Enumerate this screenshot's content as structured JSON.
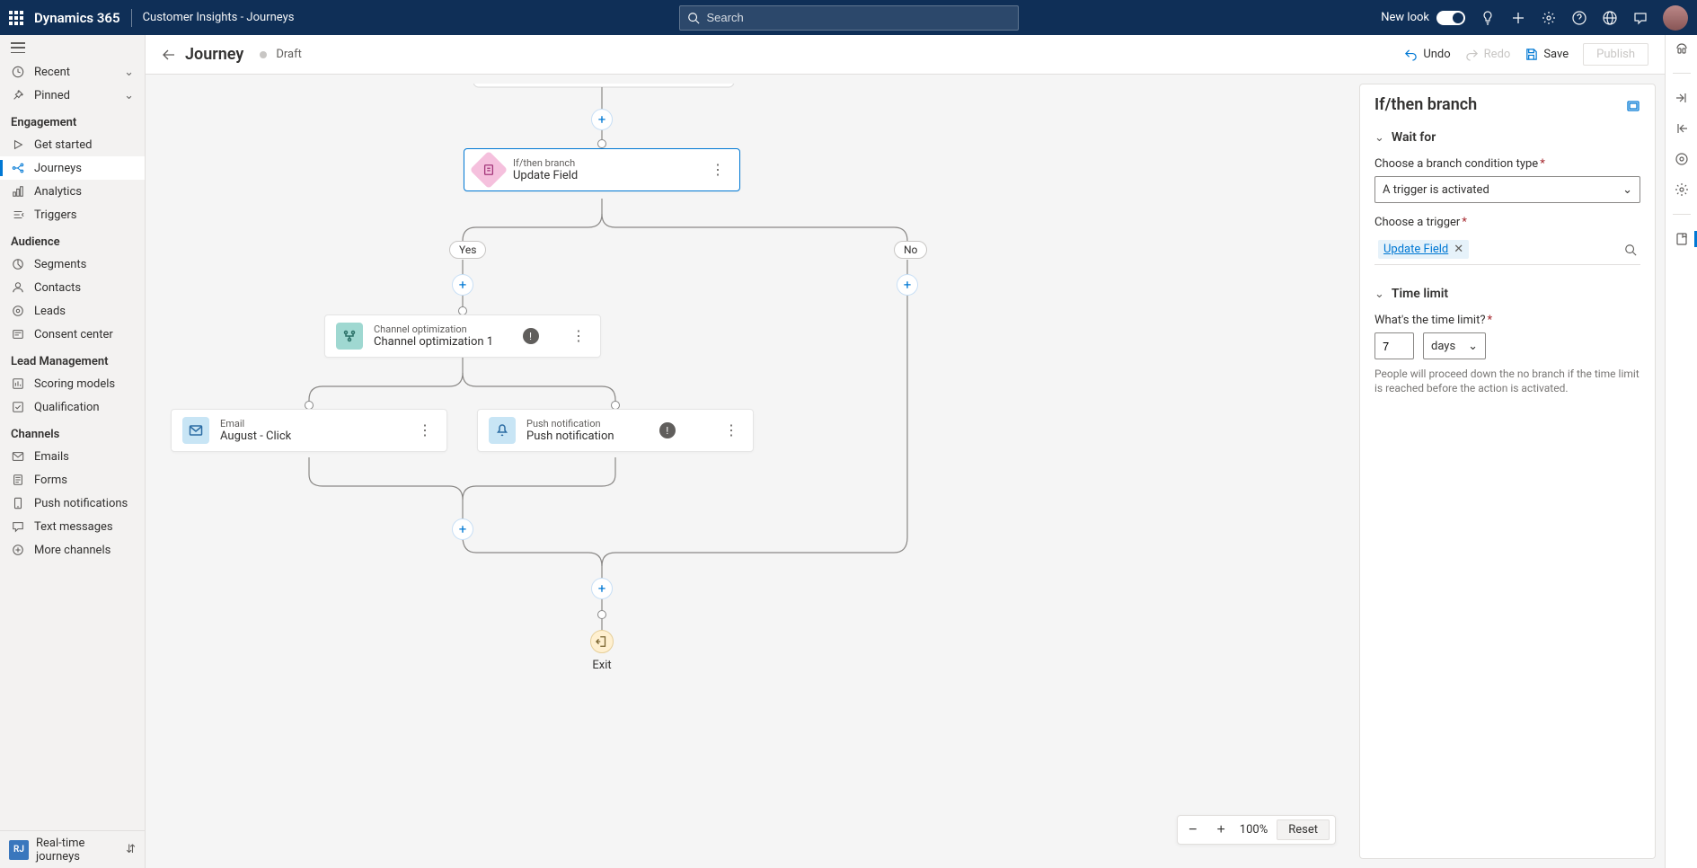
{
  "topbar": {
    "brand": "Dynamics 365",
    "app": "Customer Insights - Journeys",
    "search_placeholder": "Search",
    "new_look_label": "New look"
  },
  "sidebar": {
    "recent": "Recent",
    "pinned": "Pinned",
    "sections": {
      "engagement": "Engagement",
      "audience": "Audience",
      "lead": "Lead Management",
      "channels": "Channels"
    },
    "items": {
      "get_started": "Get started",
      "journeys": "Journeys",
      "analytics": "Analytics",
      "triggers": "Triggers",
      "segments": "Segments",
      "contacts": "Contacts",
      "leads": "Leads",
      "consent": "Consent center",
      "scoring": "Scoring models",
      "qualification": "Qualification",
      "emails": "Emails",
      "forms": "Forms",
      "push": "Push notifications",
      "text": "Text messages",
      "more": "More channels"
    },
    "footer": {
      "chip": "RJ",
      "label": "Real-time journeys"
    }
  },
  "cmdbar": {
    "title": "Journey",
    "status": "Draft",
    "undo": "Undo",
    "redo": "Redo",
    "save": "Save",
    "publish": "Publish"
  },
  "canvas": {
    "nodes": {
      "ifthen": {
        "small": "If/then branch",
        "big": "Update Field"
      },
      "chanopt": {
        "small": "Channel optimization",
        "big": "Channel optimization 1"
      },
      "email": {
        "small": "Email",
        "big": "August - Click"
      },
      "push": {
        "small": "Push notification",
        "big": "Push notification"
      }
    },
    "branch_yes": "Yes",
    "branch_no": "No",
    "exit": "Exit"
  },
  "zoom": {
    "value": "100%",
    "reset": "Reset"
  },
  "panel": {
    "title": "If/then branch",
    "wait_for": "Wait for",
    "branch_cond_label": "Choose a branch condition type",
    "branch_cond_value": "A trigger is activated",
    "trigger_label": "Choose a trigger",
    "trigger_value": "Update Field",
    "time_limit": "Time limit",
    "time_limit_q": "What's the time limit?",
    "time_value": "7",
    "time_unit": "days",
    "helper": "People will proceed down the no branch if the time limit is reached before the action is activated."
  }
}
